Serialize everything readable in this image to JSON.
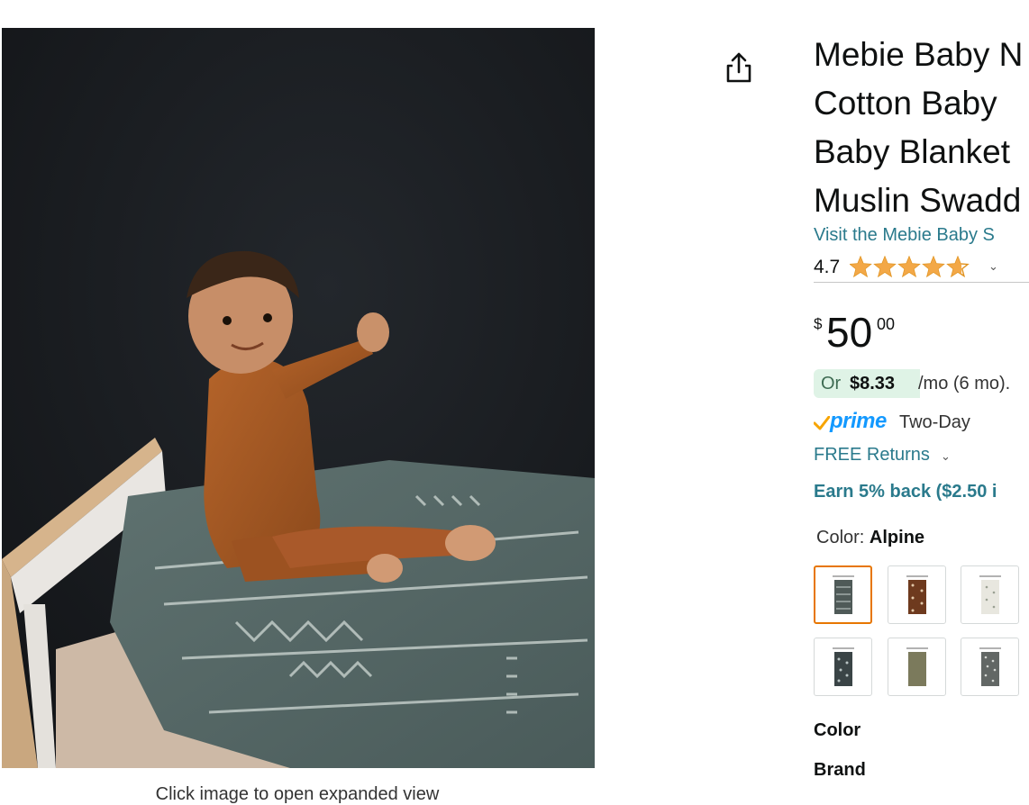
{
  "product": {
    "title_lines": [
      "Mebie Baby N",
      "Cotton Baby ",
      "Baby Blanket",
      "Muslin Swadd"
    ],
    "store_link": "Visit the Mebie Baby S",
    "rating": "4.7",
    "rating_fraction": 0.94,
    "price": {
      "currency": "$",
      "whole": "50",
      "fraction": "00"
    },
    "monthly": {
      "or": "Or",
      "amount": "$8.33",
      "rest": "/mo (6 mo)."
    },
    "prime": {
      "word": "prime",
      "delivery": "Two-Day"
    },
    "returns": "FREE Returns",
    "earn": "Earn 5% back ($2.50 i",
    "color_label": "Color:",
    "color_value": "Alpine",
    "swatches": [
      "Alpine",
      "swatch-2",
      "swatch-3",
      "swatch-4",
      "swatch-5",
      "swatch-6"
    ],
    "spec_labels": [
      "Color",
      "Brand"
    ]
  },
  "image": {
    "caption": "Click image to open expanded view"
  },
  "colors": {
    "link": "#2a7a8c",
    "prime_blue": "#1399ff",
    "prime_check": "#f7a400",
    "star": "#f3a847",
    "selected_border": "#e77600",
    "monthly_bg": "#dff3e6"
  },
  "icons": [
    "share-icon",
    "star-icon",
    "chevron-down-icon",
    "prime-check-icon"
  ]
}
